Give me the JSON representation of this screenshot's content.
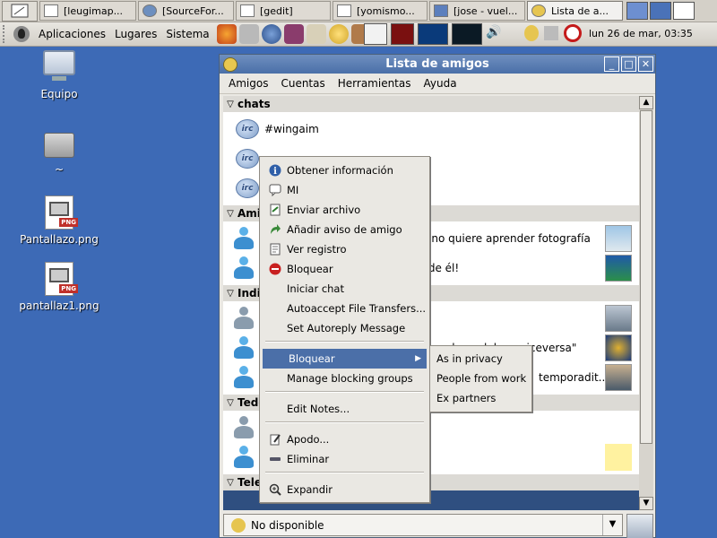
{
  "taskbar": {
    "tasks": [
      {
        "label": "[leugimap...",
        "active": false
      },
      {
        "label": "[SourceFor...",
        "active": false
      },
      {
        "label": "[gedit]",
        "active": false
      },
      {
        "label": "[yomismo...",
        "active": false
      },
      {
        "label": "[jose - vuel...",
        "active": false
      },
      {
        "label": "Lista de a...",
        "active": true
      }
    ]
  },
  "panel": {
    "menus": [
      "Aplicaciones",
      "Lugares",
      "Sistema"
    ],
    "clock": "lun 26 de mar, 03:35"
  },
  "desktop": {
    "icons": [
      {
        "label": "Equipo",
        "icon": "computer-icon"
      },
      {
        "label": "~",
        "icon": "home-folder-icon"
      },
      {
        "label": "Pantallazo.png",
        "icon": "png-file-icon"
      },
      {
        "label": "pantallaz1.png",
        "icon": "png-file-icon"
      }
    ]
  },
  "window": {
    "title": "Lista de amigos",
    "menu": [
      "Amigos",
      "Cuentas",
      "Herramientas",
      "Ayuda"
    ],
    "groups": {
      "chats": "chats",
      "amigos": "Amig",
      "indiv": "Indiv",
      "tedo": "Tedo",
      "tele": "Tele"
    },
    "chat_rows": [
      "#wingaim"
    ],
    "row_texts": [
      "que no quiere aprender fotografía",
      "ma de él!",
      "que me las pelaba y viceversa\"",
      "temporadit..."
    ],
    "status": "No disponible"
  },
  "context_menu": {
    "items": [
      {
        "label": "Obtener información",
        "icon": "info-icon"
      },
      {
        "label": "MI",
        "icon": "im-icon"
      },
      {
        "label": "Enviar archivo",
        "icon": "send-file-icon"
      },
      {
        "label": "Añadir aviso de amigo",
        "icon": "buddy-pounce-icon"
      },
      {
        "label": "Ver registro",
        "icon": "log-icon"
      },
      {
        "label": "Bloquear",
        "icon": "block-icon"
      },
      {
        "label": "Iniciar chat",
        "icon": ""
      },
      {
        "label": "Autoaccept File Transfers...",
        "icon": ""
      },
      {
        "label": "Set Autoreply Message",
        "icon": ""
      },
      {
        "label": "Bloquear",
        "icon": "",
        "highlighted": true,
        "submenu": true
      },
      {
        "label": "Manage blocking groups",
        "icon": ""
      },
      {
        "label": "Edit Notes...",
        "icon": ""
      },
      {
        "label": "Apodo...",
        "icon": "edit-icon"
      },
      {
        "label": "Eliminar",
        "icon": "remove-icon"
      },
      {
        "label": "Expandir",
        "icon": "zoom-icon"
      }
    ],
    "submenu": [
      "As in privacy",
      "People from work",
      "Ex partners"
    ]
  },
  "colors": {
    "desktop": "#3d6ab6",
    "highlight": "#4b6fa8",
    "titlebar": "#4a6fa8"
  }
}
